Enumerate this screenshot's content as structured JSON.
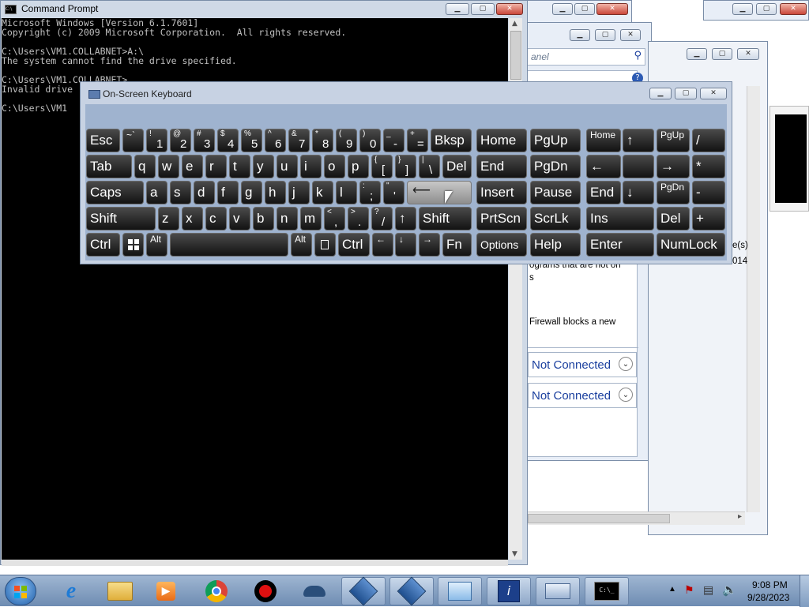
{
  "cmd": {
    "title": "Command Prompt",
    "lines": [
      "Microsoft Windows [Version 6.1.7601]",
      "Copyright (c) 2009 Microsoft Corporation.  All rights reserved.",
      "",
      "C:\\Users\\VM1.COLLABNET>A:\\",
      "The system cannot find the drive specified.",
      "",
      "C:\\Users\\VM1.COLLABNET>",
      "Invalid drive",
      "",
      "C:\\Users\\VM1"
    ]
  },
  "osk": {
    "title": "On-Screen Keyboard",
    "rows": {
      "r1": [
        "Esc",
        "~`",
        "!1",
        "@2",
        "#3",
        "$4",
        "%5",
        "^6",
        "&7",
        "*8",
        "(9",
        ")0",
        "_-",
        "+=",
        "Bksp"
      ],
      "r2": [
        "Tab",
        "q",
        "w",
        "e",
        "r",
        "t",
        "y",
        "u",
        "i",
        "o",
        "p",
        "{[",
        "}]",
        "|\\",
        "Del"
      ],
      "r3": [
        "Caps",
        "a",
        "s",
        "d",
        "f",
        "g",
        "h",
        "j",
        "k",
        "l",
        ":;",
        "\"'",
        "Enter"
      ],
      "r4": [
        "Shift",
        "z",
        "x",
        "c",
        "v",
        "b",
        "n",
        "m",
        "<,",
        ">.",
        "?/",
        "↑",
        "Shift"
      ],
      "r5": [
        "Ctrl",
        "Win",
        "Alt",
        "Space",
        "Alt",
        "Menu",
        "Ctrl",
        "←",
        "↓",
        "→",
        "Fn"
      ]
    },
    "nav": {
      "home": "Home",
      "pgup": "PgUp",
      "end": "End",
      "pgdn": "PgDn",
      "insert": "Insert",
      "pause": "Pause",
      "prtscn": "PrtScn",
      "scrlk": "ScrLk",
      "options": "Options",
      "help": "Help"
    },
    "numpad": {
      "home": "Home",
      "up": "↑",
      "pgup": "PgUp",
      "div": "/",
      "left": "←",
      "blank": "",
      "right": "→",
      "mul": "*",
      "end": "End",
      "down": "↓",
      "pgdn": "PgDn",
      "minus": "-",
      "ins": "Ins",
      "del": "Del",
      "plus": "+",
      "enter": "Enter",
      "numlock": "NumLock"
    }
  },
  "background": {
    "search_placeholder": "anel",
    "text_programs": "ograms that are not on",
    "text_s": "s",
    "text_firewall": "Firewall blocks a new",
    "not_connected_1": "Not Connected",
    "not_connected_2": "Not Connected",
    "text_es": "e(s)",
    "text_014": "014"
  },
  "taskbar": {
    "time": "9:08 PM",
    "date": "9/28/2023"
  }
}
